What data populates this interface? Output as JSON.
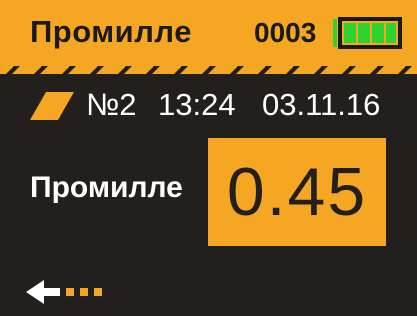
{
  "header": {
    "title": "Промилле",
    "counter": "0003",
    "battery_icon": "battery-full-icon",
    "battery_level": 1.0
  },
  "info": {
    "mode_icon": "parallelogram-mode-icon",
    "measurement_number": "№2",
    "time": "13:24",
    "date": "03.11.16"
  },
  "result": {
    "label": "Промилле",
    "value": "0.45"
  },
  "footer": {
    "back_icon": "arrow-left-icon"
  },
  "colors": {
    "accent": "#f5a623",
    "background": "#231f1d",
    "battery_green": "#2fd32f",
    "text_light": "#ffffff",
    "text_dark": "#1a1a1a"
  }
}
